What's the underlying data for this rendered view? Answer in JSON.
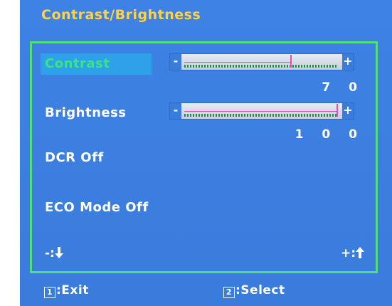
{
  "title": "Contrast/Brightness",
  "menu": {
    "contrast": {
      "label": "Contrast",
      "value": "7 0",
      "level": 0.7
    },
    "brightness": {
      "label": "Brightness",
      "value": "1 0 0",
      "level": 1.0
    },
    "dcr": {
      "label": "DCR Off"
    },
    "eco": {
      "label": "ECO Mode Off"
    }
  },
  "slider": {
    "minus": "-",
    "plus": "+"
  },
  "nav": {
    "down_label": "-:",
    "up_label": "+:",
    "down_icon": "down-arrow-icon",
    "up_icon": "up-arrow-icon"
  },
  "footer": {
    "exit_key": "1",
    "exit_label": ":Exit",
    "select_key": "2",
    "select_label": ":Select"
  },
  "colors": {
    "background": "#3a7cdc",
    "title": "#ffd24a",
    "panel_border": "#4fe07a",
    "selected_bg": "#2fa0ea",
    "selected_text": "#34e87d",
    "marker": "#e54fb5"
  }
}
